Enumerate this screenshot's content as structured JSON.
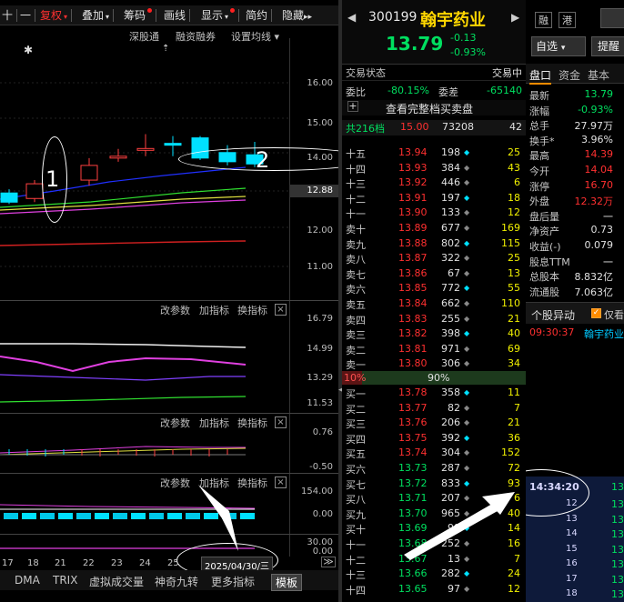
{
  "toolbar": {
    "items": [
      {
        "label": "十",
        "red": false
      },
      {
        "label": "一",
        "red": false
      },
      {
        "label": "复权",
        "red": true,
        "caret": true
      },
      {
        "label": "叠加",
        "red": false,
        "caret": true
      },
      {
        "label": "筹码",
        "red": false,
        "dot": true
      },
      {
        "label": "画线",
        "red": false
      },
      {
        "label": "显示",
        "red": false,
        "caret": true,
        "dot": true
      },
      {
        "label": "简约",
        "red": false
      },
      {
        "label": "隐藏",
        "red": false,
        "arrows": "▸▸"
      }
    ],
    "subbar": [
      "深股通",
      "融资融券",
      "设置均线"
    ]
  },
  "price_axis": [
    "16.00",
    "15.00",
    "14.00",
    "12.88",
    "12.00",
    "11.00"
  ],
  "annotations": {
    "ellipse1_label": "1",
    "ellipse2_label": "2"
  },
  "panels": [
    {
      "labels": [
        "改参数",
        "加指标",
        "换指标"
      ],
      "close": "×",
      "axis": [
        "16.79",
        "14.99",
        "13.29",
        "11.53"
      ]
    },
    {
      "labels": [
        "改参数",
        "加指标",
        "换指标"
      ],
      "close": "×",
      "axis": [
        "0.76",
        "-0.50"
      ]
    },
    {
      "labels": [
        "改参数",
        "加指标",
        "换指标"
      ],
      "close": "×",
      "axis": [
        "154.00",
        "0.00"
      ]
    },
    {
      "labels": [],
      "close": "",
      "axis": [
        "30.00",
        "0.00"
      ]
    }
  ],
  "dates": [
    "17",
    "18",
    "21",
    "22",
    "23",
    "24",
    "25"
  ],
  "date_box": "2025/04/30/三",
  "bottom_tabs": [
    "DMA",
    "TRIX",
    "虚拟成交量",
    "神奇九转",
    "更多指标",
    "模板"
  ],
  "bottom_more": "≫",
  "quote": {
    "prev": "◀",
    "code": "300199",
    "name": "翰宇药业",
    "next": "▶",
    "badge1": "融",
    "badge2": "港",
    "price": "13.79",
    "change": "-0.13",
    "change_pct": "-0.93%",
    "watch_button": "自选",
    "watch_caret": "▾",
    "remind_button": "提醒",
    "trade_status_label": "交易状态",
    "trade_status_value": "交易中",
    "weibi_label": "委比",
    "weibi_value": "-80.15%",
    "weicha_label": "委差",
    "weicha_value": "-65140",
    "full_book_link": "查看完整档买卖盘",
    "summary": {
      "levels": "共216档",
      "price": "15.00",
      "vol": "73208",
      "count": "42"
    },
    "asks": [
      {
        "label": "十五",
        "price": "13.94",
        "vol": "198",
        "cnt": "25"
      },
      {
        "label": "十四",
        "price": "13.93",
        "vol": "384",
        "cnt": "43"
      },
      {
        "label": "十三",
        "price": "13.92",
        "vol": "446",
        "cnt": "6"
      },
      {
        "label": "十二",
        "price": "13.91",
        "vol": "197",
        "cnt": "18"
      },
      {
        "label": "十一",
        "price": "13.90",
        "vol": "133",
        "cnt": "12"
      },
      {
        "label": "卖十",
        "price": "13.89",
        "vol": "677",
        "cnt": "169"
      },
      {
        "label": "卖九",
        "price": "13.88",
        "vol": "802",
        "cnt": "115"
      },
      {
        "label": "卖八",
        "price": "13.87",
        "vol": "322",
        "cnt": "25"
      },
      {
        "label": "卖七",
        "price": "13.86",
        "vol": "67",
        "cnt": "13"
      },
      {
        "label": "卖六",
        "price": "13.85",
        "vol": "772",
        "cnt": "55"
      },
      {
        "label": "卖五",
        "price": "13.84",
        "vol": "662",
        "cnt": "110"
      },
      {
        "label": "卖四",
        "price": "13.83",
        "vol": "255",
        "cnt": "21"
      },
      {
        "label": "卖三",
        "price": "13.82",
        "vol": "398",
        "cnt": "40"
      },
      {
        "label": "卖二",
        "price": "13.81",
        "vol": "971",
        "cnt": "69"
      },
      {
        "label": "卖一",
        "price": "13.80",
        "vol": "306",
        "cnt": "34"
      }
    ],
    "ratio_left": "10%",
    "ratio_right": "90%",
    "bids": [
      {
        "label": "买一",
        "price": "13.78",
        "vol": "358",
        "cnt": "11"
      },
      {
        "label": "买二",
        "price": "13.77",
        "vol": "82",
        "cnt": "7"
      },
      {
        "label": "买三",
        "price": "13.76",
        "vol": "206",
        "cnt": "21"
      },
      {
        "label": "买四",
        "price": "13.75",
        "vol": "392",
        "cnt": "36"
      },
      {
        "label": "买五",
        "price": "13.74",
        "vol": "304",
        "cnt": "152"
      },
      {
        "label": "买六",
        "price": "13.73",
        "vol": "287",
        "cnt": "72"
      },
      {
        "label": "买七",
        "price": "13.72",
        "vol": "833",
        "cnt": "93"
      },
      {
        "label": "买八",
        "price": "13.71",
        "vol": "207",
        "cnt": "6"
      },
      {
        "label": "买九",
        "price": "13.70",
        "vol": "965",
        "cnt": "40"
      },
      {
        "label": "买十",
        "price": "13.69",
        "vol": "99",
        "cnt": "14"
      },
      {
        "label": "十一",
        "price": "13.68",
        "vol": "252",
        "cnt": "16"
      },
      {
        "label": "十二",
        "price": "13.67",
        "vol": "13",
        "cnt": "7"
      },
      {
        "label": "十三",
        "price": "13.66",
        "vol": "282",
        "cnt": "24"
      },
      {
        "label": "十四",
        "price": "13.65",
        "vol": "97",
        "cnt": "12"
      }
    ]
  },
  "right": {
    "tabs": [
      "盘口",
      "资金",
      "基本"
    ],
    "stats": [
      {
        "label": "最新",
        "value": "13.79",
        "color": "#00e060"
      },
      {
        "label": "涨幅",
        "value": "-0.93%",
        "color": "#00e060"
      },
      {
        "label": "总手",
        "value": "27.97万",
        "color": "#e0e0e0"
      },
      {
        "label": "换手*",
        "value": "3.96%",
        "color": "#e0e0e0"
      },
      {
        "label": "最高",
        "value": "14.39",
        "color": "#ff3030"
      },
      {
        "label": "今开",
        "value": "14.04",
        "color": "#ff3030"
      },
      {
        "label": "涨停",
        "value": "16.70",
        "color": "#ff3030"
      },
      {
        "label": "外盘",
        "value": "12.32万",
        "color": "#ff3030"
      },
      {
        "label": "盘后量",
        "value": "一",
        "color": "#e0e0e0"
      },
      {
        "label": "净资产",
        "value": "0.73",
        "color": "#e0e0e0"
      },
      {
        "label": "收益(-)",
        "value": "0.079",
        "color": "#e0e0e0"
      },
      {
        "label": "股息TTM",
        "value": "一",
        "color": "#e0e0e0"
      },
      {
        "label": "总股本",
        "value": "8.832亿",
        "color": "#e0e0e0"
      },
      {
        "label": "流通股",
        "value": "7.063亿",
        "color": "#e0e0e0"
      }
    ],
    "alert_title": "个股异动",
    "alert_check": "仅看",
    "alert_time": "09:30:37",
    "alert_name": "翰宇药业",
    "trade_header_time": "14:34:20",
    "trade_header_val": "13",
    "trades": [
      {
        "t": "12",
        "v": "13"
      },
      {
        "t": "13",
        "v": "13"
      },
      {
        "t": "14",
        "v": "13"
      },
      {
        "t": "15",
        "v": "13"
      },
      {
        "t": "16",
        "v": "13"
      },
      {
        "t": "17",
        "v": "13"
      },
      {
        "t": "18",
        "v": "13"
      }
    ]
  },
  "chart_data": {
    "type": "candlestick",
    "title": "",
    "ylim": [
      10.5,
      16.4
    ],
    "candles": [
      {
        "o": 12.75,
        "c": 13.0,
        "h": 13.1,
        "l": 12.7,
        "up": false
      },
      {
        "o": 12.85,
        "c": 13.25,
        "h": 13.35,
        "l": 12.75,
        "up": true
      },
      {
        "o": 13.35,
        "c": 13.75,
        "h": 13.95,
        "l": 13.2,
        "up": true
      },
      {
        "o": 13.95,
        "c": 14.0,
        "h": 14.2,
        "l": 13.85,
        "up": true
      },
      {
        "o": 14.2,
        "c": 14.21,
        "h": 14.6,
        "l": 14.0,
        "up": true
      },
      {
        "o": 14.35,
        "c": 14.3,
        "h": 14.55,
        "l": 14.0,
        "up": false
      },
      {
        "o": 14.5,
        "c": 13.95,
        "h": 14.55,
        "l": 13.9,
        "up": false
      },
      {
        "o": 14.1,
        "c": 13.85,
        "h": 14.3,
        "l": 13.75,
        "up": false
      },
      {
        "o": 14.04,
        "c": 13.79,
        "h": 14.39,
        "l": 13.7,
        "up": false
      }
    ]
  }
}
